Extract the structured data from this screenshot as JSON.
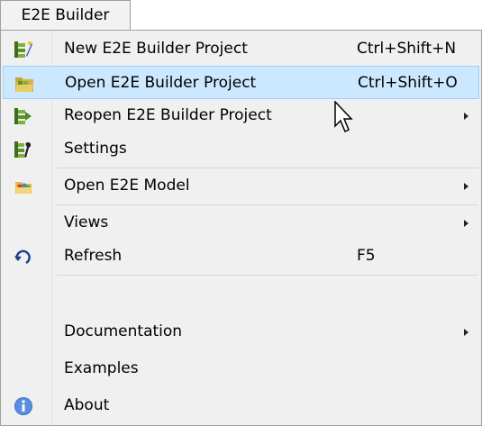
{
  "menubar": {
    "title": "E2E Builder"
  },
  "menu": {
    "items": [
      {
        "label": "New E2E Builder Project",
        "shortcut": "Ctrl+Shift+N",
        "icon": "new-project-icon"
      },
      {
        "label": "Open E2E Builder Project",
        "shortcut": "Ctrl+Shift+O",
        "icon": "open-project-icon",
        "highlighted": true
      },
      {
        "label": "Reopen E2E Builder Project",
        "icon": "reopen-project-icon",
        "submenu": true
      },
      {
        "label": "Settings",
        "icon": "settings-icon"
      },
      {
        "label": "Open E2E Model",
        "icon": "open-model-icon",
        "submenu": true
      },
      {
        "label": "Views",
        "submenu": true
      },
      {
        "label": "Refresh",
        "shortcut": "F5",
        "icon": "refresh-icon"
      },
      {
        "label": "Documentation",
        "submenu": true
      },
      {
        "label": "Examples"
      },
      {
        "label": "About",
        "icon": "info-icon"
      }
    ]
  },
  "colors": {
    "highlight_bg": "#cce8ff",
    "highlight_border": "#99d1ff",
    "menu_bg": "#f0f0f0"
  }
}
